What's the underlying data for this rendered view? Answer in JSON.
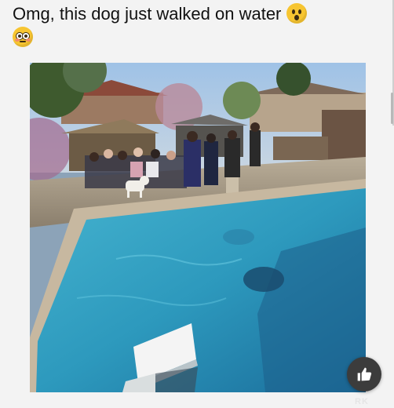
{
  "post": {
    "caption": "Omg, this dog just walked on water",
    "emojis": [
      "hushed-face",
      "flushed-face"
    ]
  },
  "video": {
    "description_icons": [
      "like-icon"
    ]
  },
  "overlay": {
    "watermark": "RK"
  },
  "colors": {
    "pool_water": "#2f9fc0",
    "pool_deep": "#1a6c9a",
    "coping": "#c7b8a0",
    "sky": "#a9c8e6",
    "like_button_bg": "#3c3c3c"
  }
}
